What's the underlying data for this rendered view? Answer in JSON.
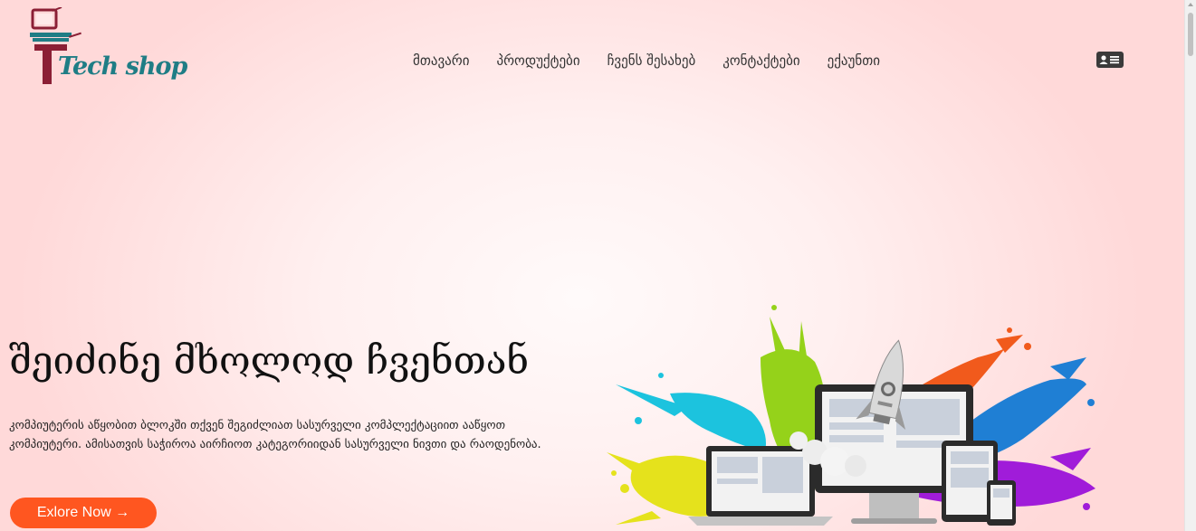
{
  "logo": {
    "text": "Tech shop",
    "icon": "computer-monitor-icon",
    "colors": {
      "teal": "#1f7d85",
      "maroon": "#8b1f35"
    }
  },
  "nav": {
    "items": [
      {
        "label": "მთავარი"
      },
      {
        "label": "პროდუქტები"
      },
      {
        "label": "ჩვენს შესახებ"
      },
      {
        "label": "კონტაქტები"
      },
      {
        "label": "ექაუნთი"
      }
    ],
    "account_icon": "contact-card-icon"
  },
  "hero": {
    "title": "შეიძინე მხოლოდ ჩვენთან",
    "description": "კომპიუტერის აწყობით ბლოკში თქვენ შეგიძლიათ სასურველი კომპლექტაციით ააწყოთ კომპიუტერი. ამისათვის საჭიროა აირჩიოთ კატეგორიიდან სასურველი ნივთი და რაოდენობა.",
    "cta_label": "Exlore Now →",
    "illustration": "rocket-devices-paint-splash-illustration"
  },
  "colors": {
    "accent": "#ff5620",
    "background": "#ffe4e4",
    "text": "#333333"
  }
}
